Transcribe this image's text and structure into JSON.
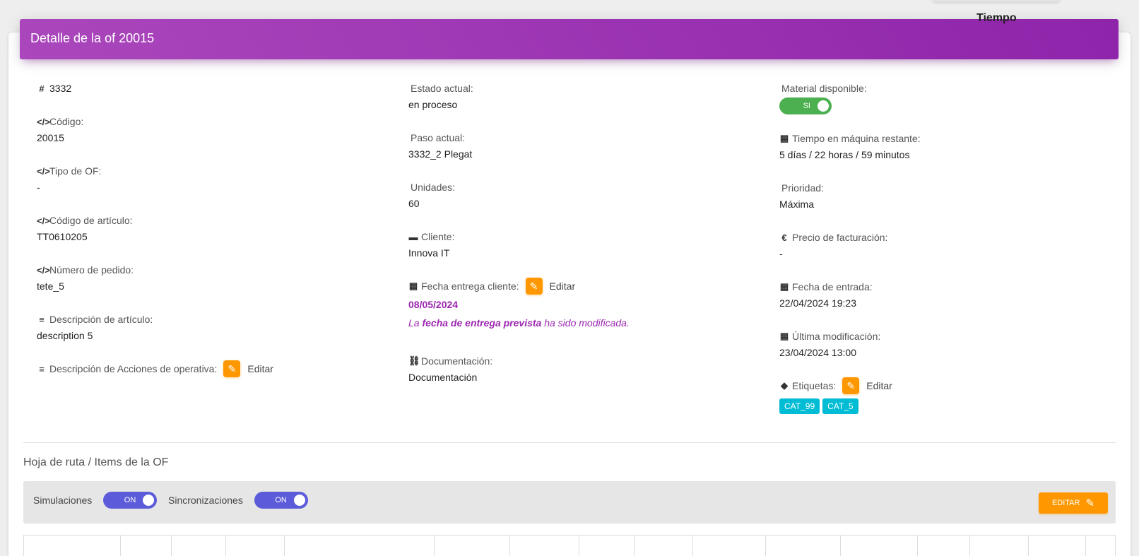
{
  "header": {
    "title": "Detalle de la of 20015"
  },
  "col1": {
    "id": {
      "icon": "hash-icon",
      "value": "3332"
    },
    "codigo": {
      "icon": "code-icon",
      "label": "Código:",
      "value": "20015"
    },
    "tipo": {
      "icon": "code-icon",
      "label": "Tipo de OF:",
      "value": "-"
    },
    "articulo": {
      "icon": "code-icon",
      "label": "Código de artículo:",
      "value": "TT0610205"
    },
    "pedido": {
      "icon": "code-icon",
      "label": "Número de pedido:",
      "value": "tete_5"
    },
    "descripcion": {
      "icon": "bars-icon",
      "label": "Descripción de artículo:",
      "value": "description 5"
    },
    "acciones": {
      "icon": "bars-icon",
      "label": "Descripción de Acciones de operativa:",
      "edit": "Editar"
    }
  },
  "col2": {
    "estado": {
      "label": "Estado actual:",
      "value": "en proceso"
    },
    "paso": {
      "label": "Paso actual:",
      "value": "3332_2 Plegat"
    },
    "unidades": {
      "label": "Unidades:",
      "value": "60"
    },
    "cliente": {
      "icon": "briefcase-icon",
      "label": "Cliente:",
      "value": "Innova IT"
    },
    "fecha_entrega": {
      "icon": "calendar-icon",
      "label": "Fecha entrega cliente:",
      "edit": "Editar",
      "value": "08/05/2024",
      "note_pre": "La",
      "note_bold": "fecha de entrega prevista",
      "note_post": "ha sido modificada."
    },
    "documentacion": {
      "icon": "link-icon",
      "label": "Documentación:",
      "value": "Documentación"
    }
  },
  "col3": {
    "material": {
      "label": "Material disponible:",
      "toggle": "SI"
    },
    "tiempo": {
      "icon": "calendar-icon",
      "label": "Tiempo en máquina restante:",
      "value": "5 días / 22 horas / 59 minutos"
    },
    "prioridad": {
      "label": "Prioridad:",
      "value": "Máxima"
    },
    "precio": {
      "icon": "euro-icon",
      "label": "Precio de facturación:",
      "value": "-"
    },
    "entrada": {
      "icon": "calendar-icon",
      "label": "Fecha de entrada:",
      "value": "22/04/2024 19:23"
    },
    "modificacion": {
      "icon": "calendar-icon",
      "label": "Última modificación:",
      "value": "23/04/2024 13:00"
    },
    "etiquetas": {
      "icon": "tag-icon",
      "label": "Etiquetas:",
      "edit": "Editar",
      "tags": [
        "CAT_99",
        "CAT_5"
      ]
    }
  },
  "route": {
    "title": "Hoja de ruta / Items de la OF",
    "simulaciones": {
      "label": "Simulaciones",
      "toggle": "ON"
    },
    "sincronizaciones": {
      "label": "Sincronizaciones",
      "toggle": "ON"
    },
    "edit_button": "EDITAR",
    "table_header_partial": "Tiempo"
  },
  "colors": {
    "header_gradient_start": "#ab47bc",
    "header_gradient_end": "#8e24aa",
    "accent_orange": "#ff9800",
    "toggle_green": "#4caf50",
    "toggle_blue": "#5c5cdb",
    "badge_cyan": "#00bcd4",
    "purple_text": "#9c27b0"
  }
}
